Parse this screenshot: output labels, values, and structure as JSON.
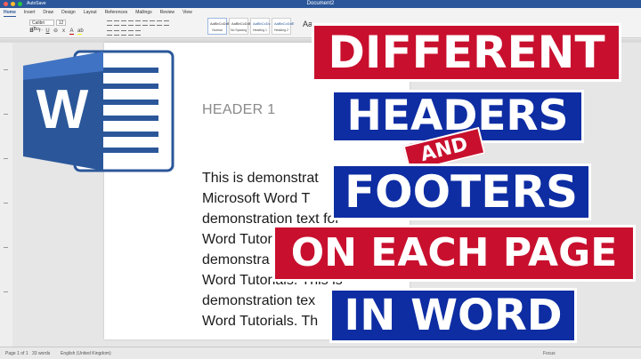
{
  "titlebar": {
    "autosave": "AutoSave",
    "doc_title": "Document2",
    "colors": {
      "close": "#ff5f57",
      "min": "#febc2e",
      "max": "#28c840"
    }
  },
  "ribbon": {
    "tabs": [
      "Home",
      "Insert",
      "Draw",
      "Design",
      "Layout",
      "References",
      "Mailings",
      "Review",
      "View"
    ],
    "font_name": "Calibri (Bo...",
    "font_size": "12",
    "format_buttons": [
      "B",
      "I",
      "U"
    ],
    "styles": [
      {
        "sample": "AaBbCcDdEe",
        "name": "Normal"
      },
      {
        "sample": "AaBbCcDdEe",
        "name": "No Spacing"
      },
      {
        "sample": "AaBbCcDc",
        "name": "Heading 1"
      },
      {
        "sample": "AaBbCcDdE",
        "name": "Heading 2"
      }
    ],
    "styles_more": "Aa"
  },
  "document": {
    "header": "HEADER 1",
    "body_lines": [
      "This is demonstrat",
      "Microsoft Word T",
      "demonstration text for",
      "Word Tutorials. Th",
      "demonstra",
      "Word Tutorials. This is",
      "demonstration tex",
      "Word Tutorials. Th"
    ]
  },
  "statusbar": {
    "page": "Page 1 of 1",
    "words": "33 words",
    "language": "English (United Kingdom)",
    "focus": "Focus"
  },
  "logo": {
    "letter": "W",
    "colors": {
      "primary": "#2b579a",
      "light": "#4a7fd4",
      "fold": "#a8c4ee"
    }
  },
  "thumbnail": {
    "lines": [
      "DIFFERENT",
      "HEADERS",
      "AND",
      "FOOTERS",
      "ON EACH PAGE",
      "IN WORD"
    ],
    "colors": {
      "red": "#c8102e",
      "blue": "#0e2da3",
      "text": "#ffffff"
    }
  }
}
